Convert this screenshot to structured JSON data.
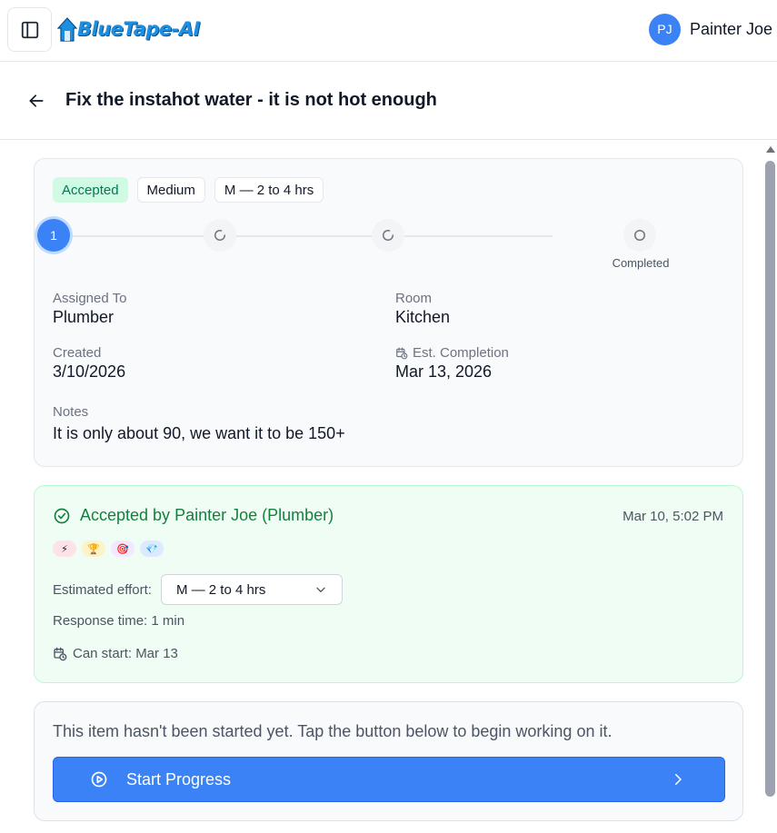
{
  "app": {
    "logo_text": "BlueTape-AI"
  },
  "user": {
    "initials": "PJ",
    "name": "Painter Joe"
  },
  "page": {
    "title": "Fix the instahot water - it is not hot enough"
  },
  "badges": {
    "status": "Accepted",
    "priority": "Medium",
    "effort": "M — 2 to 4 hrs"
  },
  "stepper": {
    "active_step": "1",
    "final_label": "Completed"
  },
  "details": {
    "assigned_to_label": "Assigned To",
    "assigned_to": "Plumber",
    "room_label": "Room",
    "room": "Kitchen",
    "created_label": "Created",
    "created": "3/10/2026",
    "est_completion_label": "Est. Completion",
    "est_completion": "Mar 13, 2026",
    "notes_label": "Notes",
    "notes": "It is only about 90, we want it to be 150+"
  },
  "acceptance": {
    "title": "Accepted by Painter Joe (Plumber)",
    "time": "Mar 10, 5:02 PM",
    "emojis": [
      "⚡",
      "🏆",
      "🎯",
      "💎"
    ],
    "effort_label": "Estimated effort:",
    "effort_value": "M — 2 to 4 hrs",
    "response_time": "Response time: 1 min",
    "can_start": "Can start: Mar 13"
  },
  "start": {
    "text": "This item hasn't been started yet. Tap the button below to begin working on it.",
    "button_label": "Start Progress"
  },
  "colors": {
    "accent": "#3b82f6",
    "success": "#15803d",
    "success_bg": "#f0fdf4"
  }
}
